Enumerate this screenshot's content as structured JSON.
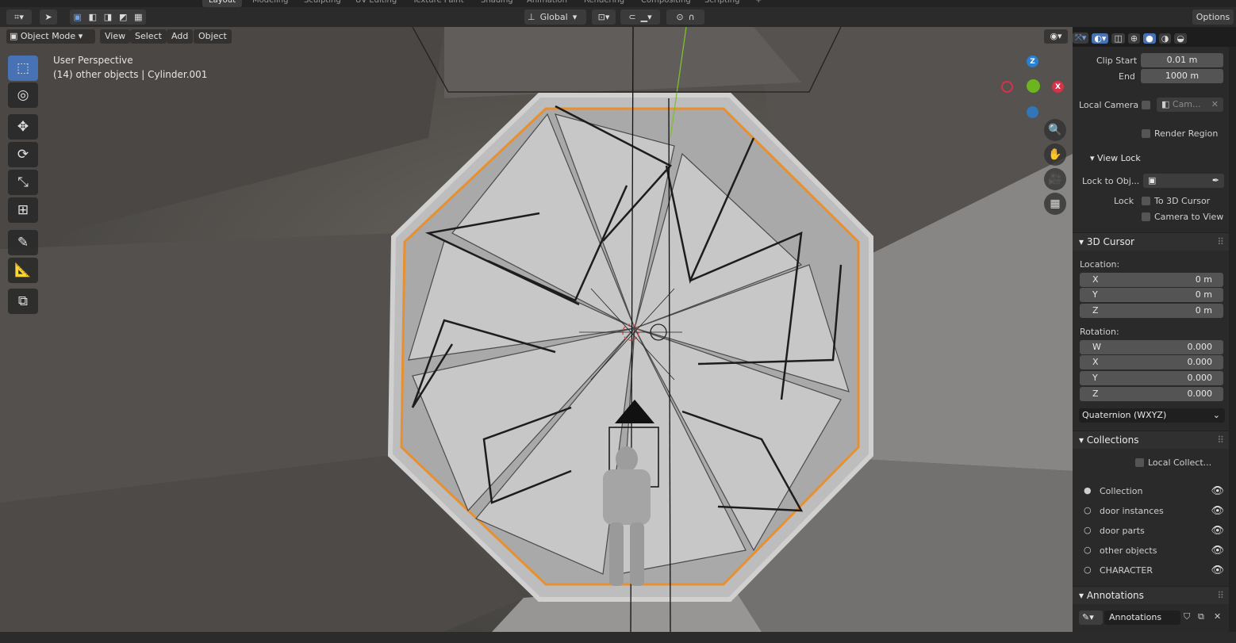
{
  "topbar": {
    "tabs": [
      "Layout",
      "Modeling",
      "Sculpting",
      "UV Editing",
      "Texture Paint",
      "Shading",
      "Animation",
      "Rendering",
      "Compositing",
      "Scripting",
      "+"
    ]
  },
  "header": {
    "transform_orientation": "Global",
    "options_label": "Options"
  },
  "menu": {
    "mode": "Object Mode",
    "items": [
      "View",
      "Select",
      "Add",
      "Object"
    ]
  },
  "viewport": {
    "perspective_label": "User Perspective",
    "object_info": "(14) other objects | Cylinder.001",
    "gizmo": {
      "z": "Z",
      "x": "X"
    }
  },
  "panel": {
    "clip_start_label": "Clip Start",
    "clip_start_value": "0.01 m",
    "clip_end_label": "End",
    "clip_end_value": "1000 m",
    "local_camera_label": "Local Camera",
    "local_camera_placeholder": "Cam...",
    "render_region_label": "Render Region",
    "view_lock_label": "View Lock",
    "lock_to_obj_label": "Lock to Obj...",
    "lock_label": "Lock",
    "to_3d_cursor_label": "To 3D Cursor",
    "camera_to_view_label": "Camera to View",
    "cursor_section": "3D Cursor",
    "location_label": "Location:",
    "location": [
      {
        "axis": "X",
        "value": "0 m"
      },
      {
        "axis": "Y",
        "value": "0 m"
      },
      {
        "axis": "Z",
        "value": "0 m"
      }
    ],
    "rotation_label": "Rotation:",
    "rotation": [
      {
        "axis": "W",
        "value": "0.000"
      },
      {
        "axis": "X",
        "value": "0.000"
      },
      {
        "axis": "Y",
        "value": "0.000"
      },
      {
        "axis": "Z",
        "value": "0.000"
      }
    ],
    "rotation_mode": "Quaternion (WXYZ)",
    "collections_section": "Collections",
    "local_collections_label": "Local Collect...",
    "collections": [
      "Collection",
      "door instances",
      "door parts",
      "other objects",
      "CHARACTER"
    ],
    "annotations_section": "Annotations",
    "annotations_value": "Annotations"
  },
  "colors": {
    "accent": "#4772b3",
    "selection_outline": "#e8902f",
    "axis_x": "#d5334a",
    "axis_y": "#6cb51e",
    "axis_z": "#2a7fd1"
  }
}
